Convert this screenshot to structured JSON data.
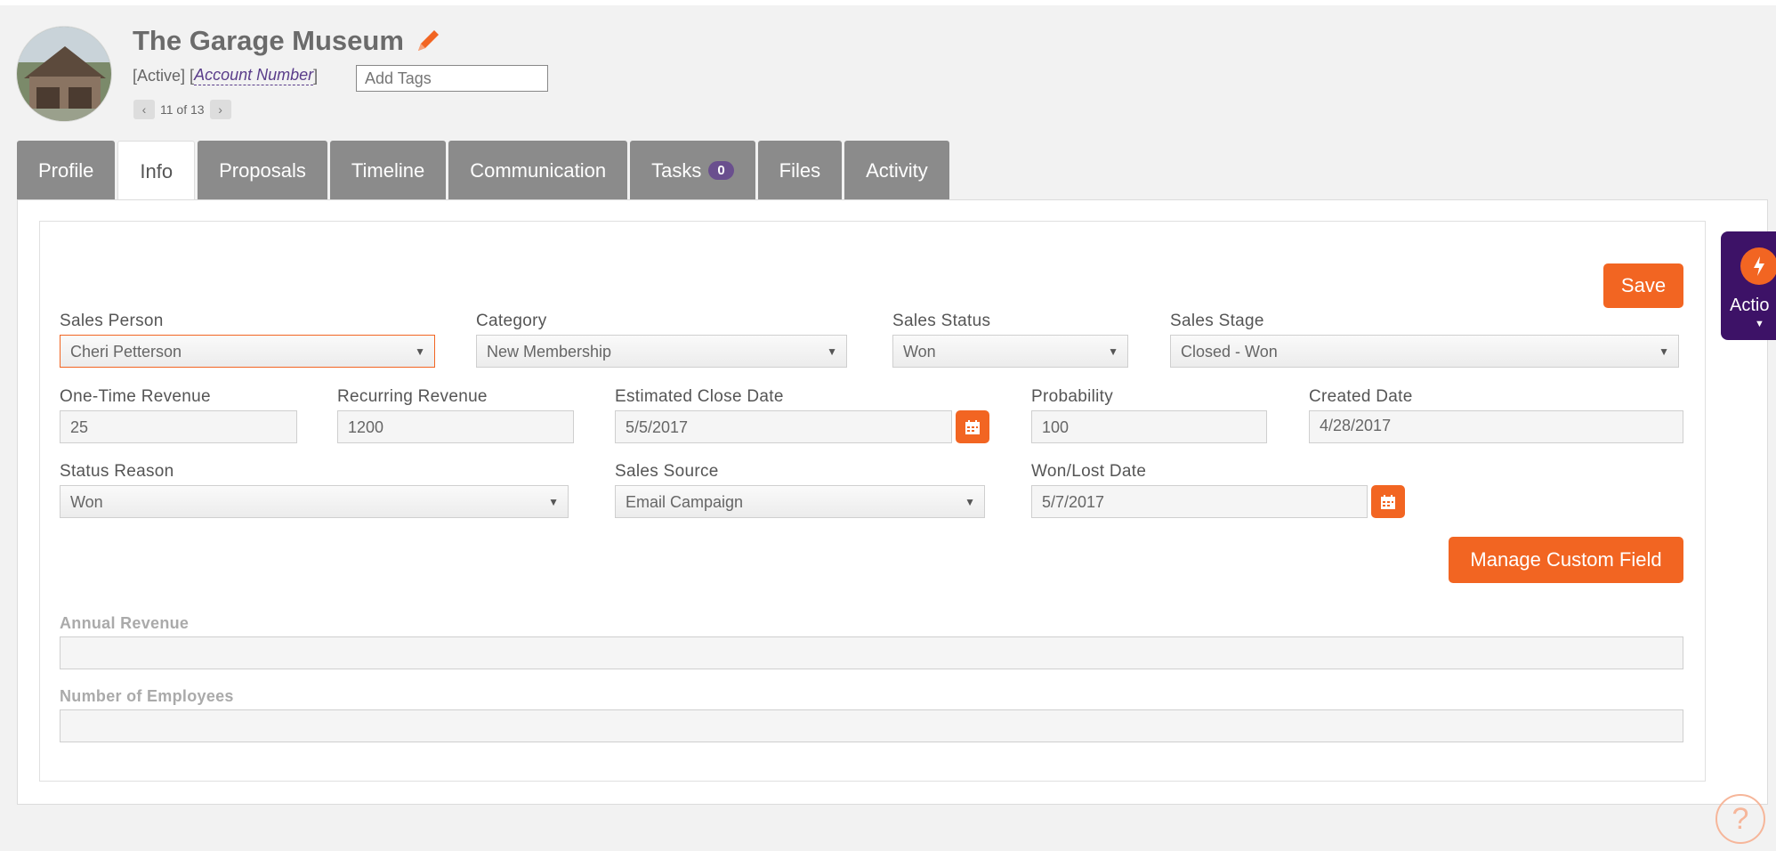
{
  "header": {
    "title": "The Garage Museum",
    "status": "[Active]",
    "account_open": "[",
    "account_number": "Account Number",
    "account_close": "]",
    "tags_placeholder": "Add Tags",
    "pager": "11 of 13"
  },
  "tabs": [
    {
      "label": "Profile"
    },
    {
      "label": "Info"
    },
    {
      "label": "Proposals"
    },
    {
      "label": "Timeline"
    },
    {
      "label": "Communication"
    },
    {
      "label": "Tasks",
      "badge": "0"
    },
    {
      "label": "Files"
    },
    {
      "label": "Activity"
    }
  ],
  "form": {
    "save_label": "Save",
    "sales_person": {
      "label": "Sales Person",
      "value": "Cheri Petterson"
    },
    "category": {
      "label": "Category",
      "value": "New Membership"
    },
    "sales_status": {
      "label": "Sales Status",
      "value": "Won"
    },
    "sales_stage": {
      "label": "Sales Stage",
      "value": "Closed - Won"
    },
    "one_time_revenue": {
      "label": "One-Time Revenue",
      "value": "25"
    },
    "recurring_revenue": {
      "label": "Recurring Revenue",
      "value": "1200"
    },
    "estimated_close_date": {
      "label": "Estimated Close Date",
      "value": "5/5/2017"
    },
    "probability": {
      "label": "Probability",
      "value": "100"
    },
    "created_date": {
      "label": "Created Date",
      "value": "4/28/2017"
    },
    "status_reason": {
      "label": "Status Reason",
      "value": "Won"
    },
    "sales_source": {
      "label": "Sales Source",
      "value": "Email Campaign"
    },
    "won_lost_date": {
      "label": "Won/Lost Date",
      "value": "5/7/2017"
    },
    "manage_custom_label": "Manage Custom Field",
    "annual_revenue": {
      "label": "Annual Revenue",
      "value": ""
    },
    "number_of_employees": {
      "label": "Number of Employees",
      "value": ""
    }
  },
  "side": {
    "actions_label": "Actio",
    "help": "?"
  },
  "colors": {
    "accent": "#f26522",
    "purple": "#3d1267",
    "tab_bg": "#8b8b8b"
  }
}
